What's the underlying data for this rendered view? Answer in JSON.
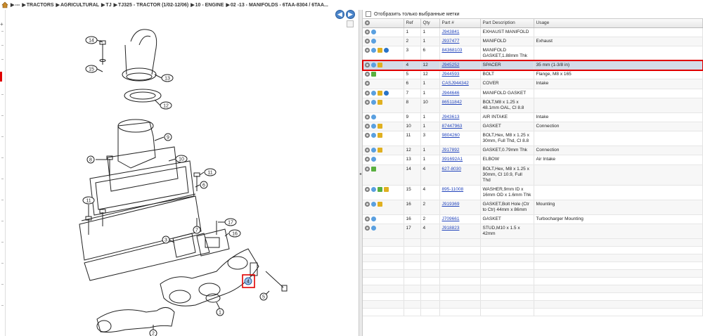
{
  "breadcrumb": {
    "items": [
      "---",
      "TRACTORS",
      "AGRICULTURAL",
      "TJ",
      "TJ325 - TRACTOR (1/02-12/06)",
      "10 - ENGINE",
      "02 -13 - MANIFOLDS - 6TAA-8304 / 6TAA..."
    ]
  },
  "nav": {
    "back_symbol": "◀",
    "forward_symbol": "▶"
  },
  "filter": {
    "label": "Отобразить только выбранные метки"
  },
  "table": {
    "headers": [
      "",
      "Ref",
      "Qty",
      "Part #",
      "Part Description",
      "Usage"
    ],
    "selected_index": 3,
    "rows": [
      {
        "icons": [
          "gear",
          "info"
        ],
        "ref": "1",
        "qty": "1",
        "part": "J943841",
        "desc": "EXHAUST MANIFOLD",
        "usage": ""
      },
      {
        "icons": [
          "gear",
          "info"
        ],
        "ref": "2",
        "qty": "1",
        "part": "J937477",
        "desc": "MANIFOLD",
        "usage": "Exhaust"
      },
      {
        "icons": [
          "gear",
          "info",
          "box",
          "globe"
        ],
        "ref": "3",
        "qty": "6",
        "part": "84368103",
        "desc": "MANIFOLD GASKET,1.88mm Thk",
        "usage": ""
      },
      {
        "icons": [
          "gear",
          "info",
          "box"
        ],
        "ref": "4",
        "qty": "12",
        "part": "J945252",
        "desc": "SPACER",
        "usage": "35 mm (1-3/8 in)"
      },
      {
        "icons": [
          "gear",
          "swap"
        ],
        "ref": "5",
        "qty": "12",
        "part": "J944593",
        "desc": "BOLT",
        "usage": "Flange, M8 x 165"
      },
      {
        "icons": [
          "gear"
        ],
        "ref": "6",
        "qty": "1",
        "part": "CASJ944342",
        "desc": "COVER",
        "usage": "Intake"
      },
      {
        "icons": [
          "gear",
          "info",
          "box",
          "globe"
        ],
        "ref": "7",
        "qty": "1",
        "part": "J944646",
        "desc": "MANIFOLD GASKET",
        "usage": ""
      },
      {
        "icons": [
          "gear",
          "info",
          "box"
        ],
        "ref": "8",
        "qty": "10",
        "part": "86511842",
        "desc": "BOLT,M8 x 1.25 x 48.1mm OAL, Cl 8.8",
        "usage": ""
      },
      {
        "icons": [
          "gear",
          "info"
        ],
        "ref": "9",
        "qty": "1",
        "part": "J943613",
        "desc": "AIR INTAKE",
        "usage": "Intake"
      },
      {
        "icons": [
          "gear",
          "info",
          "box"
        ],
        "ref": "10",
        "qty": "1",
        "part": "87447963",
        "desc": "GASKET",
        "usage": "Connection"
      },
      {
        "icons": [
          "gear",
          "info",
          "box"
        ],
        "ref": "11",
        "qty": "3",
        "part": "9804260",
        "desc": "BOLT,Hex, M8 x 1.25 x 30mm, Full Thd, Cl 8.8",
        "usage": ""
      },
      {
        "icons": [
          "gear",
          "info",
          "box"
        ],
        "ref": "12",
        "qty": "1",
        "part": "J917892",
        "desc": "GASKET,0.79mm Thk",
        "usage": "Connection"
      },
      {
        "icons": [
          "gear",
          "info"
        ],
        "ref": "13",
        "qty": "1",
        "part": "391692A1",
        "desc": "ELBOW",
        "usage": "Air Intake"
      },
      {
        "icons": [
          "gear",
          "swap"
        ],
        "ref": "14",
        "qty": "4",
        "part": "627-8030",
        "desc": "BOLT,Hex, M8 x 1.25 x 30mm, Cl 10.9, Full Thd",
        "usage": ""
      },
      {
        "icons": [
          "gear",
          "info",
          "swap",
          "box"
        ],
        "ref": "15",
        "qty": "4",
        "part": "895-11008",
        "desc": "WASHER,9mm ID x 16mm OD x 1.6mm Thk",
        "usage": ""
      },
      {
        "icons": [
          "gear",
          "info",
          "box"
        ],
        "ref": "16",
        "qty": "2",
        "part": "J919369",
        "desc": "GASKET,Bolt Hole (Ctr to Ctr) 44mm x 86mm",
        "usage": "Mounting"
      },
      {
        "icons": [
          "gear",
          "info"
        ],
        "ref": "16",
        "qty": "2",
        "part": "J709661",
        "desc": "GASKET",
        "usage": "Turbocharger Mounting"
      },
      {
        "icons": [
          "gear",
          "info"
        ],
        "ref": "17",
        "qty": "4",
        "part": "J918823",
        "desc": "STUD,M10 x 1.5 x 42mm",
        "usage": ""
      }
    ]
  },
  "callouts": [
    "14",
    "15",
    "13",
    "12",
    "9",
    "8",
    "10",
    "11",
    "6",
    "11",
    "7",
    "17",
    "16",
    "3",
    "4",
    "5",
    "1",
    "2"
  ]
}
